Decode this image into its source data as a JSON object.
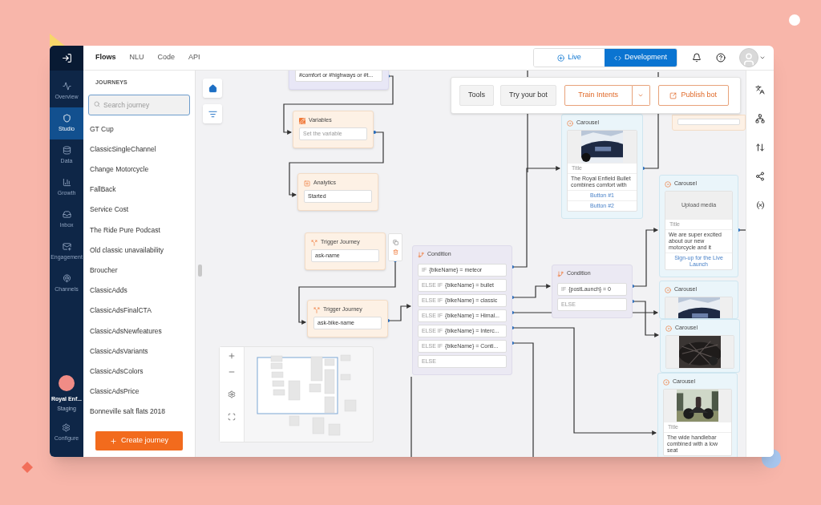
{
  "nav": {
    "items": [
      {
        "label": "Overview",
        "selected": false
      },
      {
        "label": "Studio",
        "selected": true
      },
      {
        "label": "Data",
        "selected": false
      },
      {
        "label": "Growth",
        "selected": false
      },
      {
        "label": "Inbox",
        "selected": false
      },
      {
        "label": "Engagement",
        "selected": false
      },
      {
        "label": "Channels",
        "selected": false
      }
    ],
    "workspace": {
      "name": "Royal Enf...",
      "environment": "Staging"
    },
    "configure": "Configure"
  },
  "tabs": [
    {
      "label": "Flows",
      "selected": true
    },
    {
      "label": "NLU",
      "selected": false
    },
    {
      "label": "Code",
      "selected": false
    },
    {
      "label": "API",
      "selected": false
    }
  ],
  "mode_toggle": [
    {
      "label": "Live",
      "selected": false
    },
    {
      "label": "Development",
      "selected": true
    }
  ],
  "journeys": {
    "heading": "JOURNEYS",
    "search": {
      "placeholder": "Search journey"
    },
    "items": [
      "GT Cup",
      "ClassicSingleChannel",
      "Change Motorcycle",
      "FallBack",
      "Service Cost",
      "The Ride Pure Podcast",
      "Old classic unavailability",
      "Broucher",
      "ClassicAdds",
      "ClassicAdsFinalCTA",
      "ClassicAdsNewfeatures",
      "ClassicAdsVariants",
      "ClassicAdsColors",
      "ClassicAdsPrice",
      "Bonneville salt flats 2018"
    ],
    "create_button": "Create journey"
  },
  "toolbar": {
    "buttons": [
      {
        "label": "Tools",
        "kind": "plain"
      },
      {
        "label": "Try your bot",
        "kind": "plain"
      },
      {
        "label": "Train Intents",
        "kind": "split"
      },
      {
        "label": "Publish bot",
        "kind": "publish"
      }
    ]
  },
  "nodes": [
    {
      "kind": "intent",
      "field": {
        "value": "#comfort or #highways or #t..."
      }
    },
    {
      "kind": "variables",
      "title": "Variables",
      "field": {
        "placeholder": "Set the variable"
      }
    },
    {
      "kind": "analytics",
      "title": "Analytics",
      "field": {
        "value": "Started"
      }
    },
    {
      "kind": "trigger",
      "title": "Trigger Journey",
      "field": {
        "value": "ask-name"
      }
    },
    {
      "kind": "trigger",
      "title": "Trigger Journey",
      "field": {
        "value": "ask-bike-name"
      }
    },
    {
      "kind": "condition",
      "title": "Condition",
      "branches": [
        {
          "prefix": "IF",
          "expression": "{bikeName} = meteor"
        },
        {
          "prefix": "ELSE IF",
          "expression": "{bikeName} = bullet"
        },
        {
          "prefix": "ELSE IF",
          "expression": "{bikeName} = classic"
        },
        {
          "prefix": "ELSE IF",
          "expression": "{bikeName} = Himal..."
        },
        {
          "prefix": "ELSE IF",
          "expression": "{bikeName} = Interc..."
        },
        {
          "prefix": "ELSE IF",
          "expression": "{bikeName} = Conti..."
        },
        {
          "prefix": "ELSE"
        }
      ]
    },
    {
      "kind": "carousel",
      "title": "Carousel",
      "title_placeholder": "Title",
      "text": "The Royal Enfield Bullet combines comfort with",
      "buttons": [
        "Button #1",
        "Button #2"
      ]
    },
    {
      "kind": "condition",
      "title": "Condition",
      "branches": [
        {
          "prefix": "IF",
          "expression": "{postLaunch} = 0"
        },
        {
          "prefix": "ELSE"
        }
      ]
    },
    {
      "kind": "note"
    },
    {
      "kind": "carousel",
      "title": "Carousel",
      "media_label": "Upload media",
      "title_placeholder": "Title",
      "text": "We are super excited about our new motorcycle and it",
      "link": "Sign-up for the Live Launch"
    },
    {
      "kind": "carousel",
      "title": "Carousel"
    },
    {
      "kind": "carousel",
      "title": "Carousel"
    },
    {
      "kind": "carousel",
      "title": "Carousel",
      "title_placeholder": "Title",
      "text": "The wide handlebar combined with a low seat"
    }
  ]
}
